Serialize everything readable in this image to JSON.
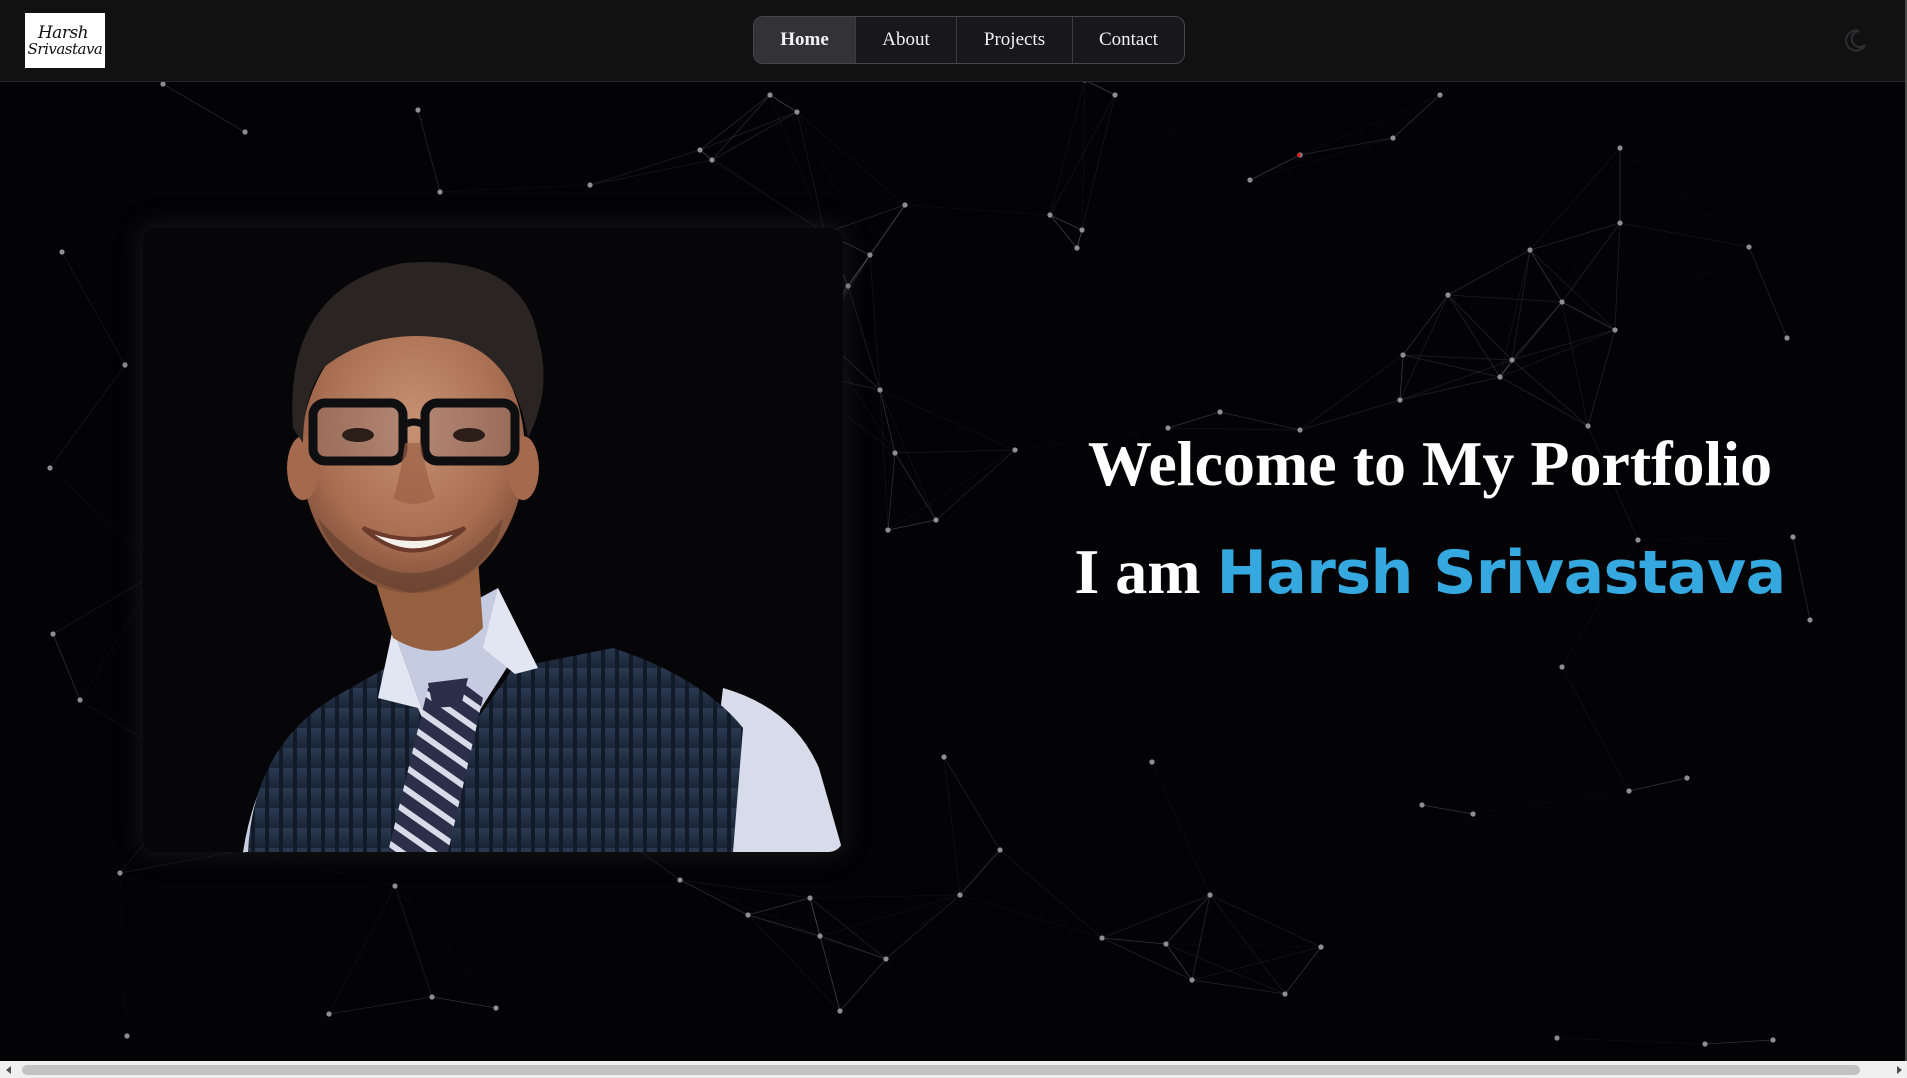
{
  "header": {
    "logo_line1": "Harsh",
    "logo_line2": "Srivastava",
    "nav": [
      {
        "label": "Home",
        "active": true
      },
      {
        "label": "About",
        "active": false
      },
      {
        "label": "Projects",
        "active": false
      },
      {
        "label": "Contact",
        "active": false
      }
    ],
    "theme_icon": "moon-icon"
  },
  "hero": {
    "title": "Welcome to My Portfolio",
    "intro": "I am ",
    "name": "Harsh Srivastava",
    "name_color": "#35a9df"
  },
  "colors": {
    "background": "#030305",
    "header_bg": "#111112",
    "accent": "#35a9df"
  },
  "scrollbar": {
    "left_icon": "arrow-left-icon",
    "right_icon": "arrow-right-icon"
  }
}
